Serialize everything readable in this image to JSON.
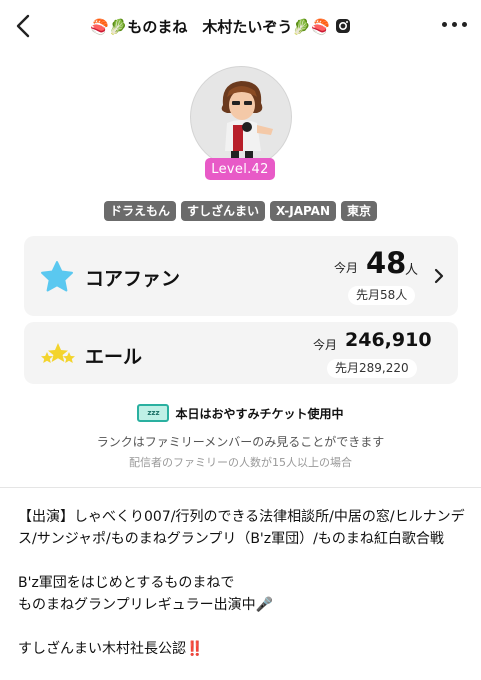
{
  "header": {
    "title": "🍣🥬ものまね　木村たいぞう🥬🍣",
    "icons": [
      "back-arrow-icon",
      "instagram-icon",
      "more-dots-icon"
    ]
  },
  "profile": {
    "level": "Level.42",
    "tags": [
      "ドラえもん",
      "すしざんまい",
      "X-JAPAN",
      "東京"
    ]
  },
  "core_fan": {
    "label": "コアファン",
    "month_label": "今月",
    "value": "48",
    "unit": "人",
    "prev": "先月58人"
  },
  "yell": {
    "label": "エール",
    "month_label": "今月",
    "value": "246,910",
    "prev": "先月289,220"
  },
  "rest": {
    "ticket_text": "zzz",
    "status": "本日はおやすみチケット使用中"
  },
  "rank_note": "ランクはファミリーメンバーのみ見ることができます",
  "rank_sub": "配信者のファミリーの人数が15人以上の場合",
  "bio": {
    "line1": "【出演】しゃべくり007/行列のできる法律相談所/中居の窓/ヒルナンデス/サンジャポ/ものまねグランプリ（B'z軍団）/ものまね紅白歌合戦",
    "line2": "B'z軍団をはじめとするものまねで",
    "line3": "ものまねグランプリレギュラー出演中🎤",
    "line4": "すしざんまい木村社長公認‼️"
  },
  "colors": {
    "level_bg": "#e85ac7",
    "tag_bg": "#6b6b6b",
    "card_bg": "#f4f4f4",
    "star_blue": "#5ac8f0",
    "star_yellow": "#f3d42c"
  }
}
